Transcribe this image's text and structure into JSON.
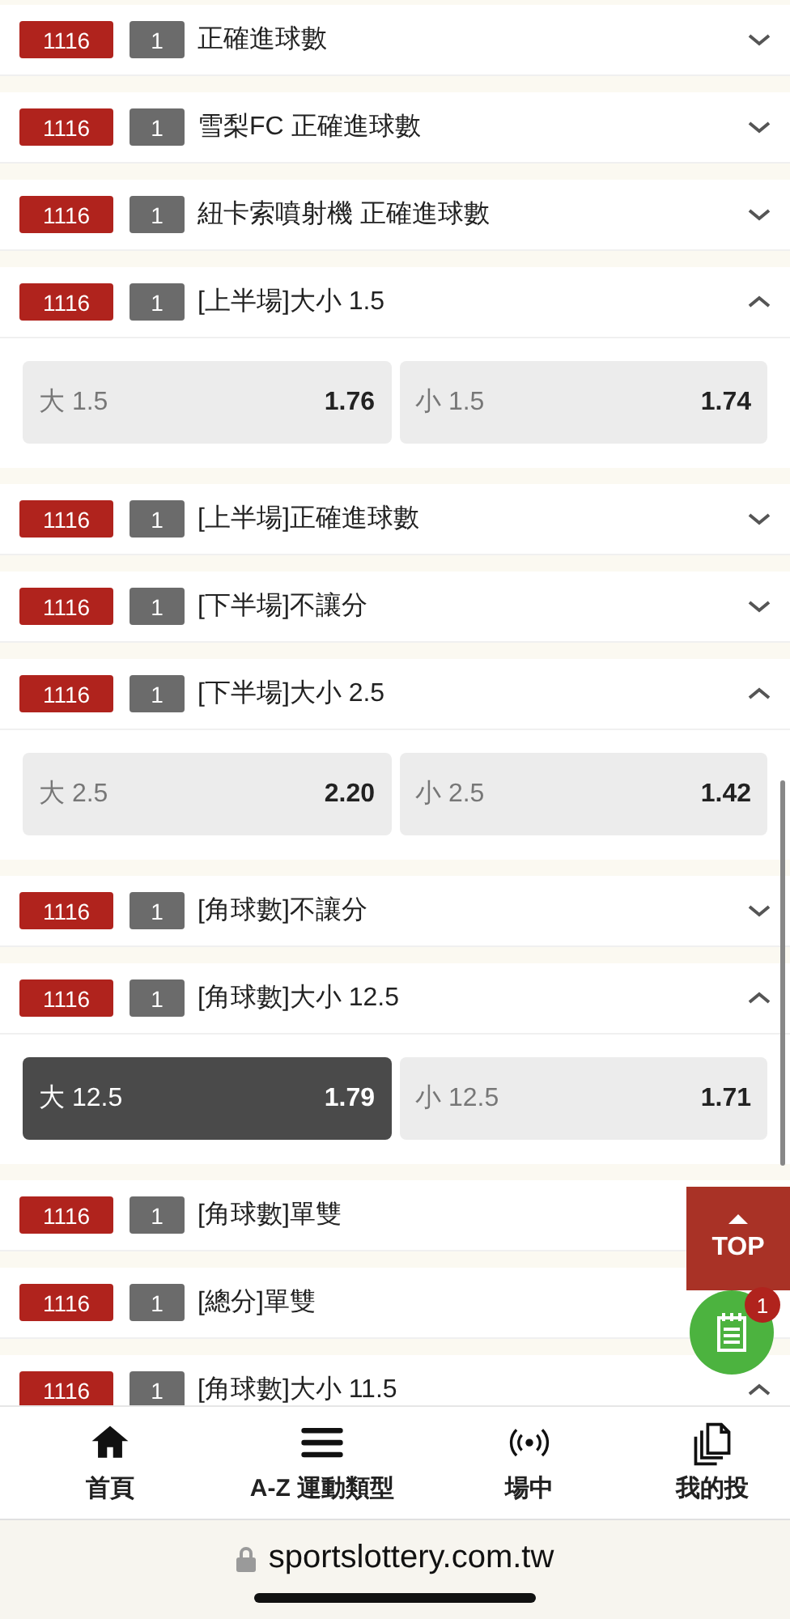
{
  "markets": [
    {
      "code": "1116",
      "num": "1",
      "title": "正確進球數",
      "expanded": false
    },
    {
      "code": "1116",
      "num": "1",
      "title": "雪梨FC 正確進球數",
      "expanded": false
    },
    {
      "code": "1116",
      "num": "1",
      "title": "紐卡索噴射機 正確進球數",
      "expanded": false
    },
    {
      "code": "1116",
      "num": "1",
      "title": "[上半場]大小 1.5",
      "expanded": true,
      "odds": [
        {
          "label": "大 1.5",
          "price": "1.76",
          "selected": false
        },
        {
          "label": "小 1.5",
          "price": "1.74",
          "selected": false
        }
      ]
    },
    {
      "code": "1116",
      "num": "1",
      "title": "[上半場]正確進球數",
      "expanded": false
    },
    {
      "code": "1116",
      "num": "1",
      "title": "[下半場]不讓分",
      "expanded": false
    },
    {
      "code": "1116",
      "num": "1",
      "title": "[下半場]大小 2.5",
      "expanded": true,
      "odds": [
        {
          "label": "大 2.5",
          "price": "2.20",
          "selected": false
        },
        {
          "label": "小 2.5",
          "price": "1.42",
          "selected": false
        }
      ]
    },
    {
      "code": "1116",
      "num": "1",
      "title": "[角球數]不讓分",
      "expanded": false
    },
    {
      "code": "1116",
      "num": "1",
      "title": "[角球數]大小 12.5",
      "expanded": true,
      "odds": [
        {
          "label": "大 12.5",
          "price": "1.79",
          "selected": true
        },
        {
          "label": "小 12.5",
          "price": "1.71",
          "selected": false
        }
      ]
    },
    {
      "code": "1116",
      "num": "1",
      "title": "[角球數]單雙"
    },
    {
      "code": "1116",
      "num": "1",
      "title": "[總分]單雙"
    },
    {
      "code": "1116",
      "num": "1",
      "title": "[角球數]大小 11.5",
      "expanded": true
    }
  ],
  "top_button": {
    "label": "TOP"
  },
  "bet_slip": {
    "count": "1"
  },
  "nav": [
    {
      "kind": "home",
      "label": "首頁"
    },
    {
      "kind": "menu",
      "label": "A-Z 運動類型"
    },
    {
      "kind": "live",
      "label": "場中"
    },
    {
      "kind": "bets",
      "label": "我的投"
    }
  ],
  "address_bar": {
    "url": "sportslottery.com.tw"
  }
}
